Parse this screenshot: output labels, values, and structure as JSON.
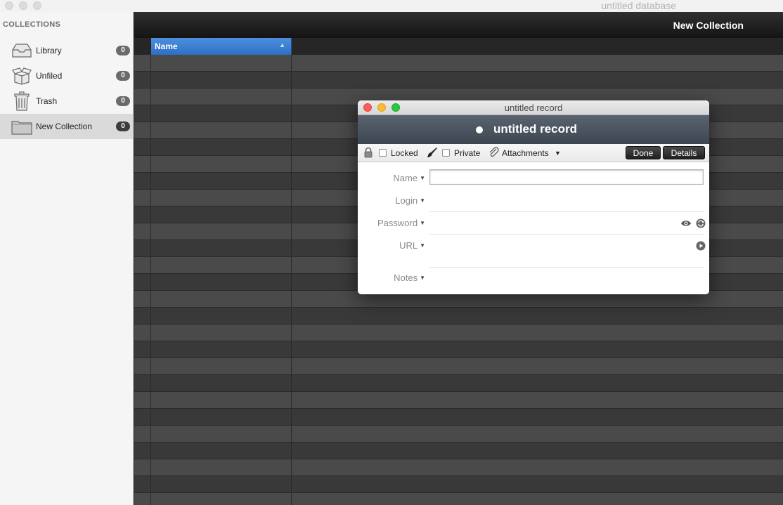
{
  "window": {
    "title": "untitled database"
  },
  "sidebar": {
    "header": "COLLECTIONS",
    "items": [
      {
        "label": "Library",
        "count": "0",
        "icon": "tray-icon"
      },
      {
        "label": "Unfiled",
        "count": "0",
        "icon": "open-box-icon"
      },
      {
        "label": "Trash",
        "count": "0",
        "icon": "trash-icon"
      },
      {
        "label": "New Collection",
        "count": "0",
        "icon": "folder-icon",
        "selected": true
      }
    ]
  },
  "main": {
    "collection_title": "New Collection",
    "columns": [
      {
        "label": "Name",
        "sort": "ascending"
      }
    ],
    "sort_arrow": "▲"
  },
  "dialog": {
    "title": "untitled record",
    "record_name": "untitled record",
    "toolbar": {
      "locked_label": "Locked",
      "private_label": "Private",
      "attachments_label": "Attachments",
      "attachments_arrow": "▼",
      "done_label": "Done",
      "details_label": "Details"
    },
    "fields": {
      "name_label": "Name",
      "login_label": "Login",
      "password_label": "Password",
      "url_label": "URL",
      "notes_label": "Notes",
      "arrow": "▼",
      "name_value": ""
    }
  },
  "colors": {
    "accent_header": "#3a7bd5",
    "close": "#fc5f57",
    "minimize": "#fdbc2e",
    "maximize": "#28c840"
  }
}
